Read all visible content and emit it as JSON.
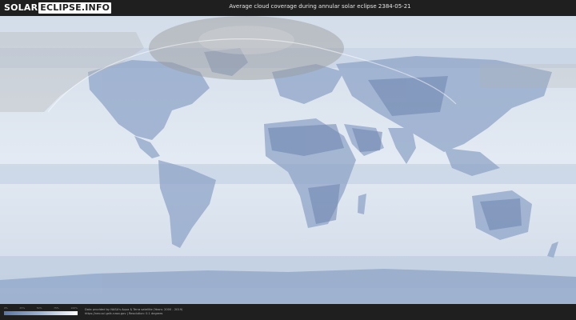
{
  "header": {
    "logo_part1": "SOLAR",
    "logo_part2": "ECLIPSE.INFO",
    "title": "Average cloud coverage during annular solar eclipse 2384-05-21"
  },
  "legend": {
    "labels": [
      "0%",
      "25%",
      "50%",
      "75%",
      "100%"
    ],
    "colors": [
      "#5a78a8",
      "#9fb4d4",
      "#ffffff"
    ]
  },
  "footer": {
    "credit_line1": "Data provided by NASA's Aqua & Terra satellite (Years: 2000 - 2019)",
    "credit_line2": "https://neo.sci.gsfc.nasa.gov | Resolution: 0.1 degrees"
  },
  "map": {
    "ocean_color": "#dbe4ef",
    "land_cloud_color": "#7890b8",
    "night_shade_color": "#b8b8b8"
  }
}
